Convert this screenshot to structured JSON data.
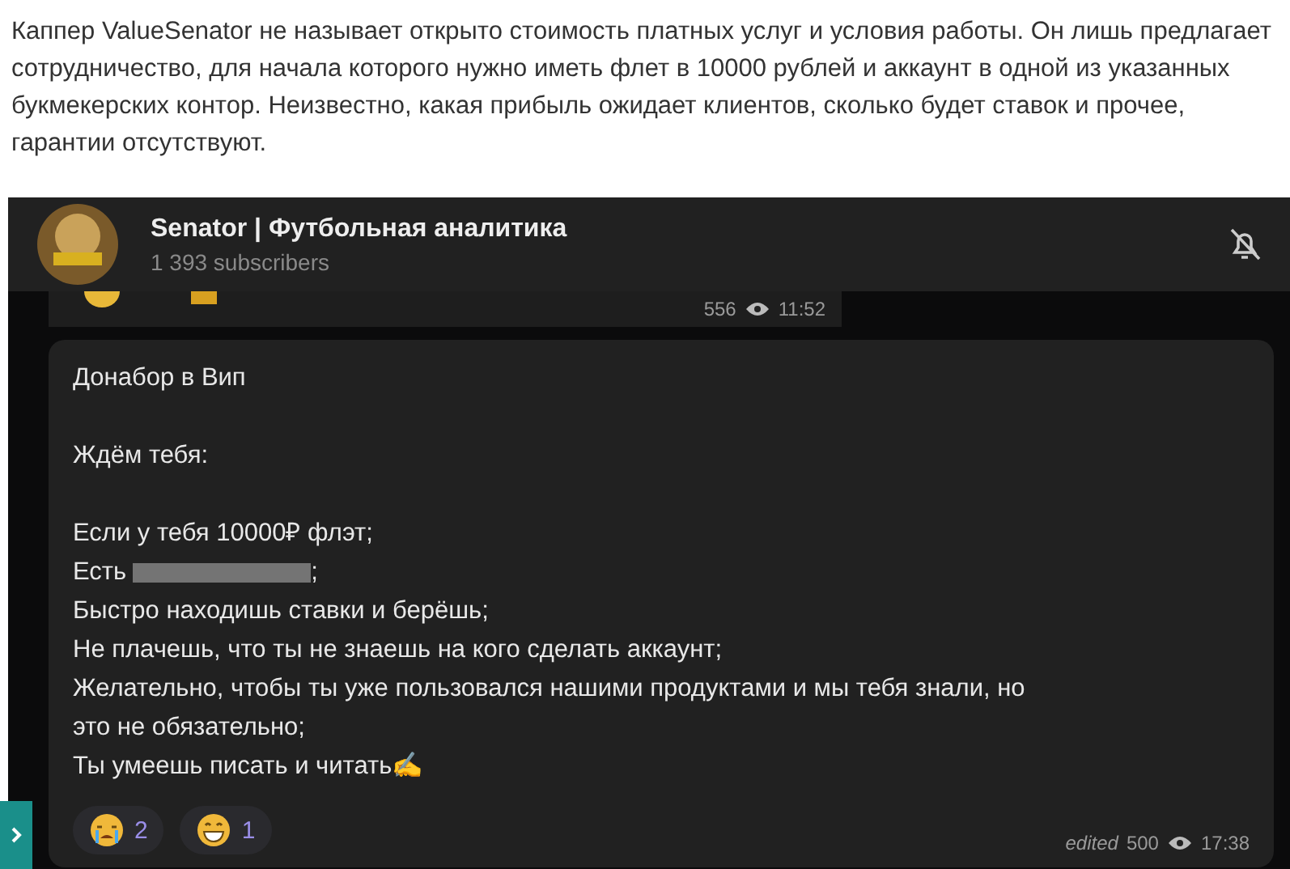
{
  "article": {
    "paragraph": "Каппер ValueSenator не называет открыто стоимость платных услуг и условия работы. Он лишь предлагает сотрудничество, для начала которого нужно иметь флет в 10000 рублей и аккаунт в одной из указанных букмекерских контор. Неизвестно, какая прибыль ожидает клиентов, сколько будет ставок и прочее, гарантии отсутствуют."
  },
  "channel": {
    "title": "Senator | Футбольная аналитика",
    "subscribers": "1 393 subscribers",
    "muted": true
  },
  "previous_message": {
    "views": "556",
    "time": "11:52"
  },
  "message": {
    "lines": [
      {
        "kind": "text",
        "text": "Донабор в Вип"
      },
      {
        "kind": "blank"
      },
      {
        "kind": "text",
        "text": "Ждём тебя:"
      },
      {
        "kind": "blank"
      },
      {
        "kind": "text",
        "text": "Если у тебя 10000₽ флэт;"
      },
      {
        "kind": "redacted",
        "before": "Есть",
        "after": ";"
      },
      {
        "kind": "text",
        "text": "Быстро находишь ставки и берёшь;"
      },
      {
        "kind": "text",
        "text": "Не плачешь, что ты не знаешь на кого сделать аккаунт;"
      },
      {
        "kind": "text",
        "text": "Желательно, чтобы ты уже пользовался нашими продуктами и мы тебя знали, но"
      },
      {
        "kind": "text",
        "text": "это не обязательно;"
      },
      {
        "kind": "text",
        "text": "Ты умеешь писать и читать✍"
      }
    ],
    "reactions": [
      {
        "kind": "crying",
        "count": "2"
      },
      {
        "kind": "grinning",
        "count": "1"
      }
    ],
    "edited": "edited",
    "views": "500",
    "time": "17:38"
  }
}
